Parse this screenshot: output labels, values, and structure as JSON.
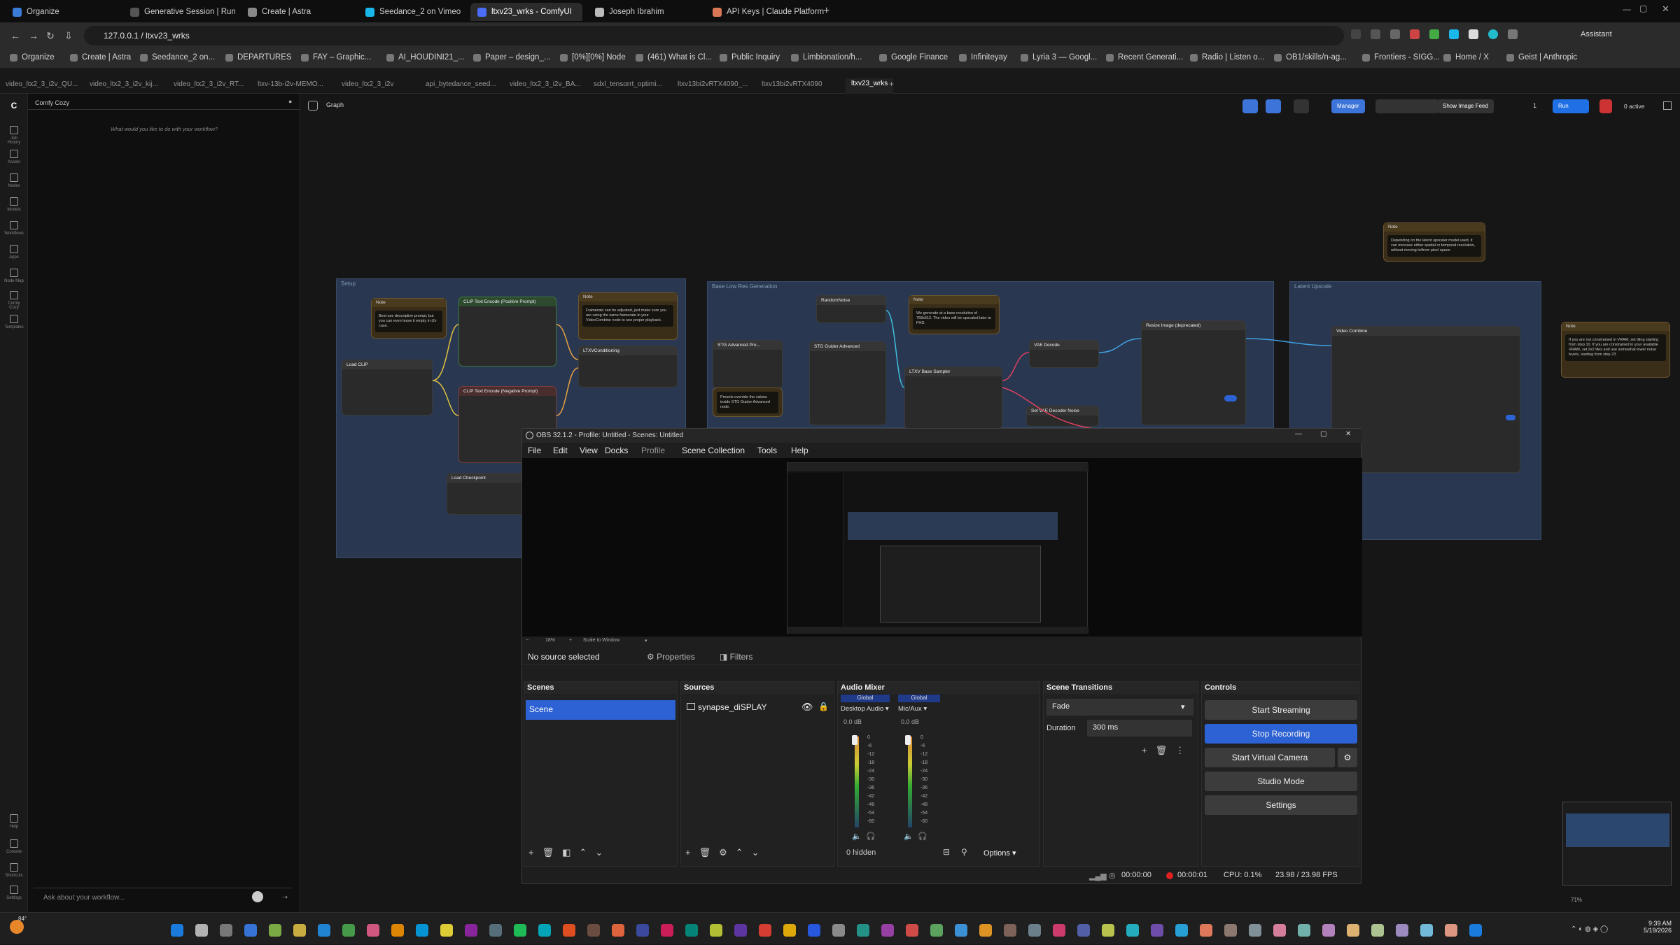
{
  "browser": {
    "tabs": [
      {
        "label": "Organize",
        "active": false
      },
      {
        "label": "Generative Session | Runw",
        "active": false
      },
      {
        "label": "Create | Astra",
        "active": false
      },
      {
        "label": "Seedance_2 on Vimeo",
        "active": false
      },
      {
        "label": "ltxv23_wrks - ComfyUI",
        "active": true
      },
      {
        "label": "Joseph Ibrahim",
        "active": false
      },
      {
        "label": "API Keys | Claude Platform",
        "active": false
      }
    ],
    "new_tab": "+",
    "url": "127.0.0.1 / ltxv23_wrks",
    "assistant": "Assistant",
    "bookmarks": [
      "Organize",
      "Create | Astra",
      "Seedance_2 on...",
      "DEPARTURES",
      "FAY – Graphic...",
      "AI_HOUDINI21_...",
      "Paper – design_...",
      "[0%][0%] Node",
      "(461) What is Cl...",
      "Public Inquiry",
      "Limbionation/h...",
      "Google Finance",
      "Infiniteyay",
      "Lyria 3 — Googl...",
      "Recent Generati...",
      "Radio | Listen o...",
      "OB1/skills/n-ag...",
      "Frontiers - SIGG...",
      "Home / X",
      "Geist | Anthropic"
    ]
  },
  "workflow_tabs": [
    "video_ltx2_3_i2v_QU...",
    "video_ltx2_3_i2v_kij...",
    "video_ltx2_3_i2v_RT...",
    "ltxv-13b-i2v-MEMO...",
    "video_ltx2_3_i2v",
    "api_bytedance_seed...",
    "video_ltx2_3_i2v_BA...",
    "sdxl_tensorrt_optimi...",
    "ltxv13bi2vRTX4090_...",
    "ltxv13bi2vRTX4090",
    "ltxv23_wrks"
  ],
  "comfy": {
    "rail": [
      "Job History",
      "Assets",
      "Nodes",
      "Models",
      "Workflows",
      "Apps",
      "Node Map",
      "Comfy Cozy",
      "Templates",
      "Help",
      "Console",
      "Shortcuts",
      "Settings"
    ],
    "chat_title": "Comfy Cozy",
    "chat_hint": "What would you like to do with your workflow?",
    "chat_placeholder": "Ask about your workflow...",
    "graph_label": "Graph",
    "manager": "Manager",
    "show_image_feed": "Show Image Feed",
    "run": "Run",
    "queue_count": "1",
    "active": "0 active",
    "zoom": "71%",
    "groups": {
      "setup": "Setup",
      "base": "Base Low Res Generation",
      "latent": "Latent Upscale"
    },
    "nodes": {
      "note": "Note",
      "clip_pos": "CLIP Text Encode (Positive Prompt)",
      "clip_neg": "CLIP Text Encode (Negative Prompt)",
      "load_clip": "Load CLIP",
      "load_ckpt": "Load Checkpoint",
      "ltxv_cond": "LTXVConditioning",
      "random_noise": "RandomNoise",
      "stg_adv": "STG Advanced Pre...",
      "stg_guider": "STG Guider Advanced",
      "ltxv_sampler": "LTXV Base Sampler",
      "vae_decode": "VAE Decode",
      "set_vae": "Set VAE Decoder Noise",
      "resize": "Resize Image (deprecated)",
      "video_combine": "Video Combine"
    },
    "note_texts": {
      "n1": "Best use descriptive prompt, but you can even leave it empty in i2v case.",
      "n2": "Framerate can be adjusted, just make sure you are using the same framerate in your VideoCombine node to see proper playback.",
      "n3": "We generate at a base resolution of 768x512. The video will be upscaled later to FHD.",
      "n4": "Depending on the latent upscaler model used, it can increase either spatial or temporal resolution, without moving to/from pixel space.",
      "n5": "If you are not constrained in VRAM, set tiling starting from step 10. If you are constrained in your available VRAM, set 2x2 tiles and use somewhat lower noise levels, starting from step 23.",
      "n6": "Presets override the values inside STG Guider Advanced node."
    }
  },
  "obs": {
    "title": "OBS 32.1.2 - Profile: Untitled - Scenes: Untitled",
    "menu": [
      "File",
      "Edit",
      "View",
      "Docks",
      "Profile",
      "Scene Collection",
      "Tools",
      "Help"
    ],
    "zoom": "18%",
    "scale": "Scale to Window",
    "no_source": "No source selected",
    "properties": "Properties",
    "filters": "Filters",
    "scenes_title": "Scenes",
    "scene": "Scene",
    "sources_title": "Sources",
    "source": "synapse_diSPLAY",
    "mixer_title": "Audio Mixer",
    "ch1": {
      "badge": "Global",
      "name": "Desktop Audio",
      "db": "0.0 dB"
    },
    "ch2": {
      "badge": "Global",
      "name": "Mic/Aux",
      "db": "0.0 dB"
    },
    "meter_ticks": [
      "0",
      "-6",
      "-12",
      "-18",
      "-24",
      "-30",
      "-36",
      "-42",
      "-48",
      "-54",
      "-60"
    ],
    "hidden": "0 hidden",
    "options": "Options",
    "transitions_title": "Scene Transitions",
    "transition": "Fade",
    "duration_label": "Duration",
    "duration": "300 ms",
    "controls_title": "Controls",
    "buttons": {
      "stream": "Start Streaming",
      "record": "Stop Recording",
      "vcam": "Start Virtual Camera",
      "studio": "Studio Mode",
      "settings": "Settings"
    },
    "status": {
      "stream_time": "00:00:00",
      "rec_time": "00:00:01",
      "cpu": "CPU: 0.1%",
      "fps": "23.98 / 23.98 FPS"
    }
  },
  "taskbar": {
    "temp": "84°",
    "time": "9:39 AM",
    "date": "5/19/2026"
  },
  "colors": {
    "accent": "#2d62d4",
    "group": "#2b3b55",
    "note": "#3a2e18",
    "run": "#1f6fe5",
    "record": "#e02020"
  }
}
